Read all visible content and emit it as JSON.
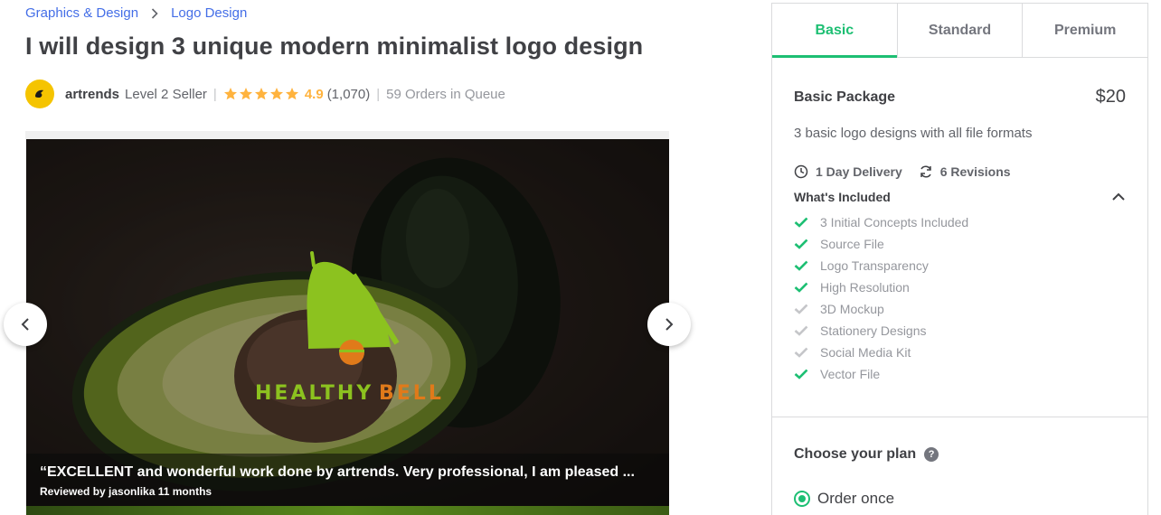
{
  "breadcrumb": {
    "items": [
      "Graphics & Design",
      "Logo Design"
    ]
  },
  "gig": {
    "title": "I will design 3 unique modern minimalist logo design"
  },
  "seller": {
    "name": "artrends",
    "level": "Level 2 Seller",
    "rating": "4.9",
    "rating_count": "(1,070)",
    "stars": 5,
    "queue": "59 Orders in Queue"
  },
  "gallery": {
    "logo_text_1": "HEALTHY",
    "logo_text_2": "BELL",
    "review_text": "“EXCELLENT and wonderful work done by artrends. Very professional, I am pleased ...",
    "review_by": "Reviewed by jasonlika 11 months"
  },
  "packages": {
    "tabs": [
      "Basic",
      "Standard",
      "Premium"
    ],
    "active_tab": "Basic",
    "name": "Basic Package",
    "price": "$20",
    "description": "3 basic logo designs with all file formats",
    "delivery": "1 Day Delivery",
    "revisions": "6 Revisions",
    "included_label": "What's Included",
    "features": [
      {
        "label": "3 Initial Concepts Included",
        "included": true
      },
      {
        "label": "Source File",
        "included": true
      },
      {
        "label": "Logo Transparency",
        "included": true
      },
      {
        "label": "High Resolution",
        "included": true
      },
      {
        "label": "3D Mockup",
        "included": false
      },
      {
        "label": "Stationery Designs",
        "included": false
      },
      {
        "label": "Social Media Kit",
        "included": false
      },
      {
        "label": "Vector File",
        "included": true
      }
    ]
  },
  "plan": {
    "title": "Choose your plan",
    "help": "?",
    "option": "Order once"
  },
  "colors": {
    "accent": "#1dbf73",
    "link": "#446ee7",
    "star": "#ffb33e",
    "check_off": "#c5c6c9"
  }
}
